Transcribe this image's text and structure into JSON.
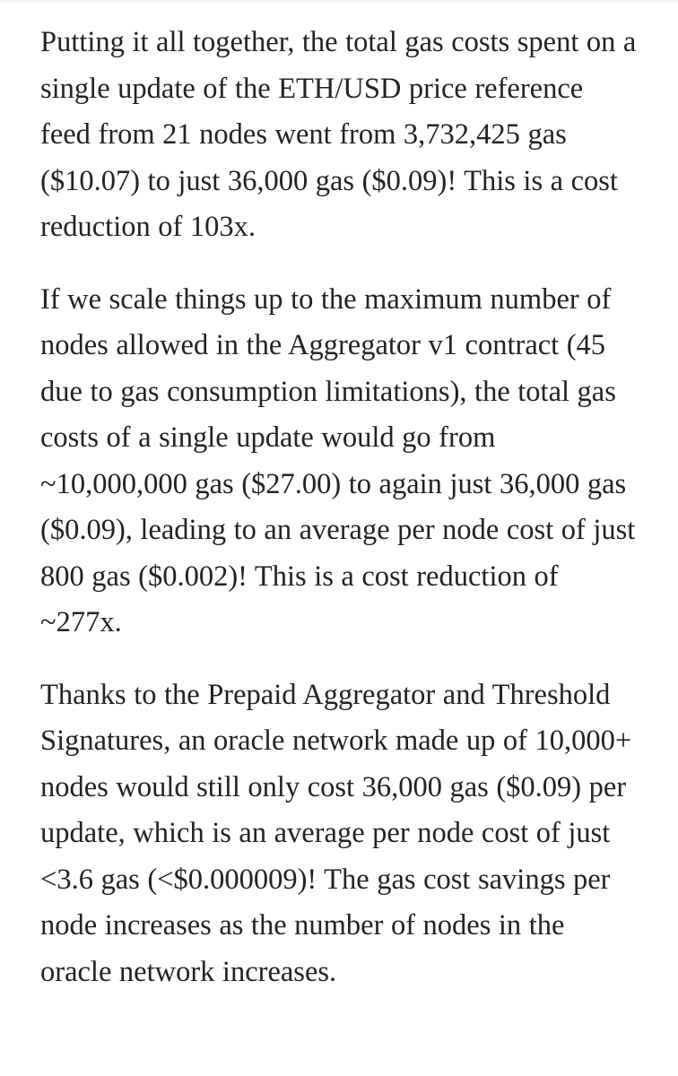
{
  "document": {
    "background_color": "#ffffff",
    "text_color": "#232325",
    "paragraphs": [
      {
        "id": "p1",
        "text": "Putting it all together, the total gas costs spent on a single update of the ETH/USD price reference feed from 21 nodes went from 3,732,425 gas ($10.07) to just 36,000 gas ($0.09)! This is a cost reduction of 103x."
      },
      {
        "id": "p2",
        "text": "If we scale things up to the maximum number of nodes allowed in the Aggregator v1 contract (45 due to gas consumption limitations), the total gas costs of a single update would go from ~10,000,000 gas ($27.00) to again just 36,000 gas ($0.09), leading to an average per node cost of just 800 gas ($0.002)! This is a cost reduction of ~277x."
      },
      {
        "id": "p3",
        "text": "Thanks to the Prepaid Aggregator and Threshold Signatures, an oracle network made up of 10,000+ nodes would still only cost 36,000 gas ($0.09) per update, which is an average per node cost of just <3.6 gas (<$0.000009)! The gas cost savings per node increases as the number of nodes in the oracle network increases."
      }
    ]
  }
}
